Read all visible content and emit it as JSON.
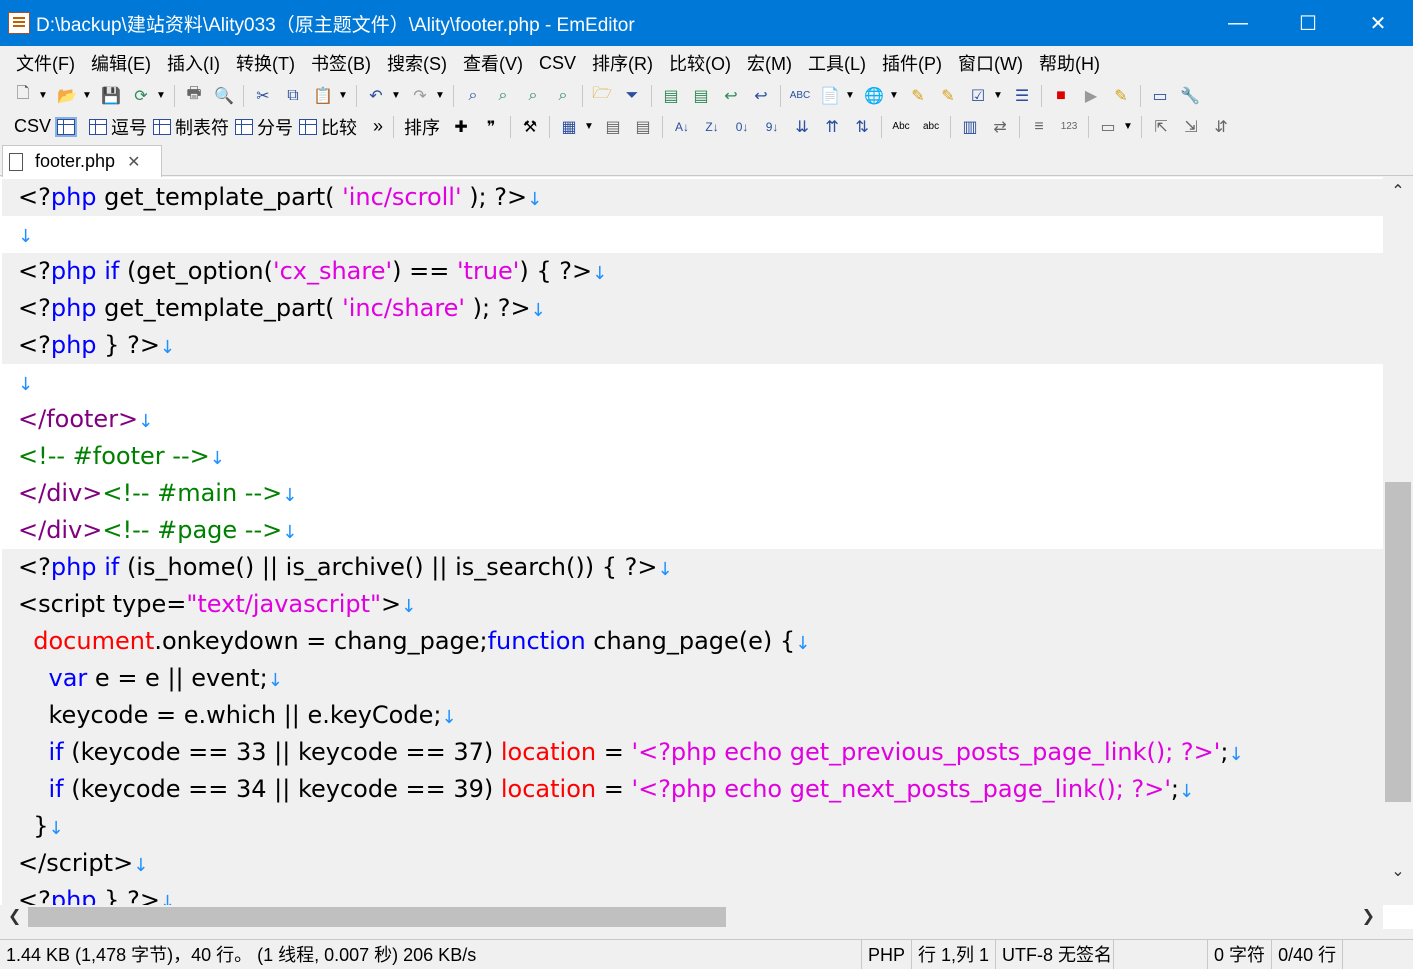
{
  "window": {
    "title": "D:\\backup\\建站资料\\Ality033（原主题文件）\\Ality\\footer.php - EmEditor",
    "minimize_glyph": "—",
    "maximize_glyph": "☐",
    "close_glyph": "✕",
    "accent_color": "#0078d7"
  },
  "menu": [
    "文件(F)",
    "编辑(E)",
    "插入(I)",
    "转换(T)",
    "书签(B)",
    "搜索(S)",
    "查看(V)",
    "CSV",
    "排序(R)",
    "比较(O)",
    "宏(M)",
    "工具(L)",
    "插件(P)",
    "窗口(W)",
    "帮助(H)"
  ],
  "toolbar2": {
    "csv": "CSV",
    "comma": "逗号",
    "tab": "制表符",
    "semicolon": "分号",
    "compare": "比较",
    "more": "»",
    "sort": "排序"
  },
  "tab": {
    "label": "footer.php",
    "close_glyph": "✕"
  },
  "code": {
    "eol": "↓"
  },
  "status": {
    "size": "1.44 KB (1,478 字节)，40 行。 (1 线程, 0.007 秒) 206 KB/s",
    "mode": "PHP",
    "position": "行 1,列 1",
    "encoding": "UTF-8 无签名",
    "chars": "0 字符",
    "lines": "0/40 行"
  }
}
